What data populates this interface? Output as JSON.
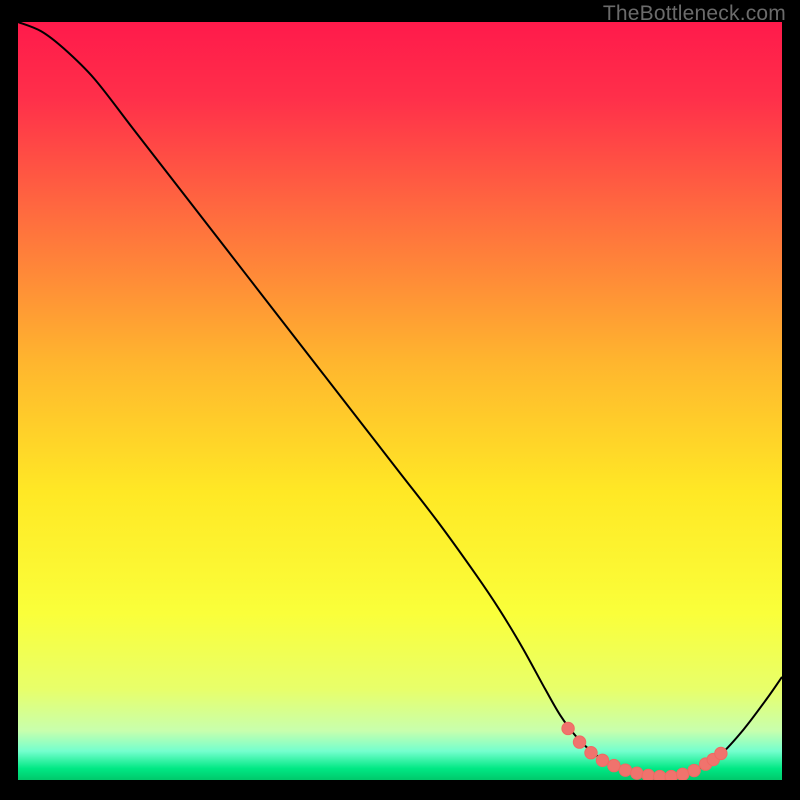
{
  "watermark": "TheBottleneck.com",
  "colors": {
    "gradient_stops": [
      {
        "offset": 0.0,
        "color": "#ff1a4b"
      },
      {
        "offset": 0.1,
        "color": "#ff2f4a"
      },
      {
        "offset": 0.25,
        "color": "#ff6a3f"
      },
      {
        "offset": 0.45,
        "color": "#ffb62e"
      },
      {
        "offset": 0.62,
        "color": "#ffe825"
      },
      {
        "offset": 0.78,
        "color": "#faff3a"
      },
      {
        "offset": 0.88,
        "color": "#e8ff6a"
      },
      {
        "offset": 0.935,
        "color": "#c8ffad"
      },
      {
        "offset": 0.962,
        "color": "#74ffce"
      },
      {
        "offset": 0.985,
        "color": "#00e884"
      },
      {
        "offset": 1.0,
        "color": "#00c86b"
      }
    ],
    "curve": "#000000",
    "marker_fill": "#f0736d",
    "marker_stroke": "#ef6a63"
  },
  "chart_data": {
    "type": "line",
    "title": "",
    "xlabel": "",
    "ylabel": "",
    "xlim": [
      0,
      100
    ],
    "ylim": [
      0,
      100
    ],
    "grid": false,
    "legend": false,
    "series": [
      {
        "name": "bottleneck-curve",
        "x": [
          0,
          3,
          6,
          10,
          15,
          20,
          25,
          30,
          35,
          40,
          45,
          50,
          55,
          60,
          63,
          66,
          69,
          71,
          73,
          75,
          77,
          79,
          81,
          83,
          85,
          87,
          89,
          92,
          95,
          98,
          100
        ],
        "y": [
          100,
          98.8,
          96.5,
          92.5,
          86,
          79.5,
          73,
          66.5,
          60,
          53.5,
          47,
          40.5,
          34,
          27,
          22.5,
          17.5,
          12,
          8.5,
          5.8,
          3.8,
          2.4,
          1.4,
          0.8,
          0.5,
          0.4,
          0.7,
          1.4,
          3.4,
          6.7,
          10.7,
          13.6
        ]
      }
    ],
    "markers": {
      "name": "highlight-band",
      "x": [
        72,
        73.5,
        75,
        76.5,
        78,
        79.5,
        81,
        82.5,
        84,
        85.5,
        87,
        88.5,
        90,
        91,
        92
      ],
      "y": [
        6.8,
        5.0,
        3.6,
        2.6,
        1.9,
        1.3,
        0.9,
        0.6,
        0.45,
        0.45,
        0.75,
        1.25,
        2.1,
        2.7,
        3.5
      ]
    }
  }
}
